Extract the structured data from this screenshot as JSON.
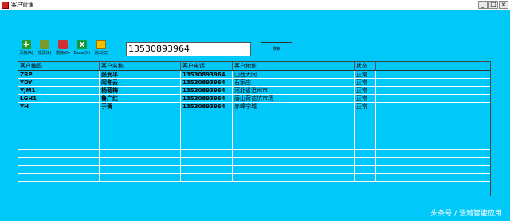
{
  "window": {
    "title": "客户管理",
    "controls": [
      "_",
      "□",
      "×"
    ]
  },
  "toolbar": {
    "buttons": [
      {
        "label": "添加(A)",
        "icon": "add-icon"
      },
      {
        "label": "修改(E)",
        "icon": "edit-icon"
      },
      {
        "label": "删除(D)",
        "icon": "delete-icon"
      },
      {
        "label": "Excel(X)",
        "icon": "excel-icon"
      },
      {
        "label": "退出(Q)",
        "icon": "exit-icon"
      }
    ]
  },
  "search": {
    "value": "13530893964",
    "button_label": "搜索"
  },
  "table": {
    "columns": [
      "客户编码",
      "客户名称",
      "客户电话",
      "客户地址",
      "状态"
    ],
    "rows": [
      [
        "ZRP",
        "张润平",
        "13530893964",
        "山西大同",
        "正常"
      ],
      [
        "YDY",
        "闫冬云",
        "13530893964",
        "石家庄",
        "正常"
      ],
      [
        "YJM1",
        "杨菊梅",
        "13530893964",
        "河北省沧州市",
        "正常"
      ],
      [
        "LGH1",
        "鲁广红",
        "13530893964",
        "唐山荷花坑市场",
        "正常"
      ],
      [
        "YH",
        "于贺",
        "13530893964",
        "赤峰宁城",
        "正常"
      ]
    ]
  },
  "watermark": "头条号 / 浩瀚智能应用",
  "colors": {
    "background": "#00c8f8",
    "grid_lines": "#ffffff"
  }
}
